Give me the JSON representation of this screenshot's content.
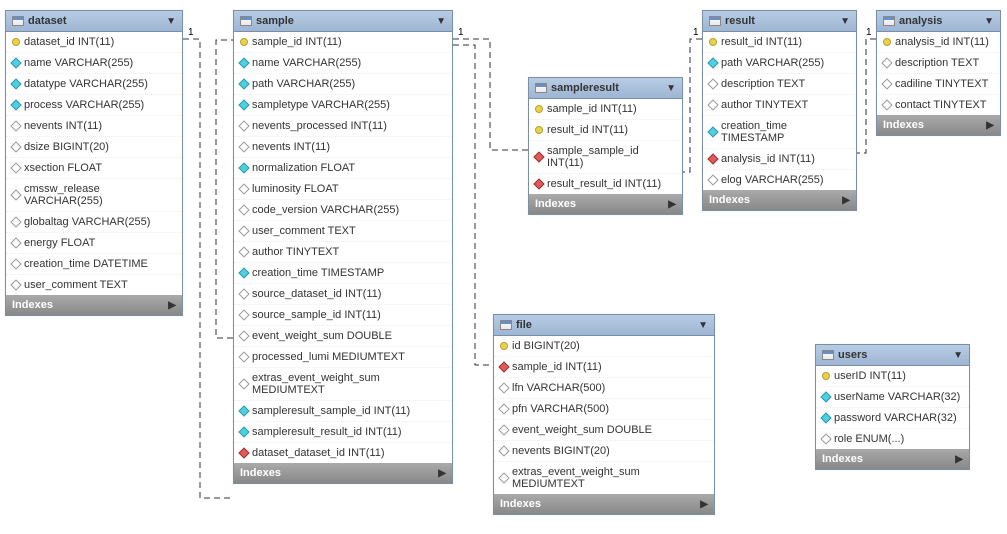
{
  "tables": {
    "dataset": {
      "title": "dataset",
      "columns": [
        {
          "icon": "key",
          "text": "dataset_id INT(11)"
        },
        {
          "icon": "cyan",
          "text": "name VARCHAR(255)"
        },
        {
          "icon": "cyan",
          "text": "datatype VARCHAR(255)"
        },
        {
          "icon": "cyan",
          "text": "process VARCHAR(255)"
        },
        {
          "icon": "open",
          "text": "nevents INT(11)"
        },
        {
          "icon": "open",
          "text": "dsize BIGINT(20)"
        },
        {
          "icon": "open",
          "text": "xsection FLOAT"
        },
        {
          "icon": "open",
          "text": "cmssw_release VARCHAR(255)"
        },
        {
          "icon": "open",
          "text": "globaltag VARCHAR(255)"
        },
        {
          "icon": "open",
          "text": "energy FLOAT"
        },
        {
          "icon": "open",
          "text": "creation_time DATETIME"
        },
        {
          "icon": "open",
          "text": "user_comment TEXT"
        }
      ],
      "indexes": "Indexes"
    },
    "sample": {
      "title": "sample",
      "columns": [
        {
          "icon": "key",
          "text": "sample_id INT(11)"
        },
        {
          "icon": "cyan",
          "text": "name VARCHAR(255)"
        },
        {
          "icon": "cyan",
          "text": "path VARCHAR(255)"
        },
        {
          "icon": "cyan",
          "text": "sampletype VARCHAR(255)"
        },
        {
          "icon": "open",
          "text": "nevents_processed INT(11)"
        },
        {
          "icon": "open",
          "text": "nevents INT(11)"
        },
        {
          "icon": "cyan",
          "text": "normalization FLOAT"
        },
        {
          "icon": "open",
          "text": "luminosity FLOAT"
        },
        {
          "icon": "open",
          "text": "code_version VARCHAR(255)"
        },
        {
          "icon": "open",
          "text": "user_comment TEXT"
        },
        {
          "icon": "open",
          "text": "author TINYTEXT"
        },
        {
          "icon": "cyan",
          "text": "creation_time TIMESTAMP"
        },
        {
          "icon": "open",
          "text": "source_dataset_id INT(11)"
        },
        {
          "icon": "open",
          "text": "source_sample_id INT(11)"
        },
        {
          "icon": "open",
          "text": "event_weight_sum DOUBLE"
        },
        {
          "icon": "open",
          "text": "processed_lumi MEDIUMTEXT"
        },
        {
          "icon": "open",
          "text": "extras_event_weight_sum MEDIUMTEXT"
        },
        {
          "icon": "cyan",
          "text": "sampleresult_sample_id INT(11)"
        },
        {
          "icon": "cyan",
          "text": "sampleresult_result_id INT(11)"
        },
        {
          "icon": "red",
          "text": "dataset_dataset_id INT(11)"
        }
      ],
      "indexes": "Indexes"
    },
    "sampleresult": {
      "title": "sampleresult",
      "columns": [
        {
          "icon": "key",
          "text": "sample_id INT(11)"
        },
        {
          "icon": "key",
          "text": "result_id INT(11)"
        },
        {
          "icon": "red",
          "text": "sample_sample_id INT(11)"
        },
        {
          "icon": "red",
          "text": "result_result_id INT(11)"
        }
      ],
      "indexes": "Indexes"
    },
    "result": {
      "title": "result",
      "columns": [
        {
          "icon": "key",
          "text": "result_id INT(11)"
        },
        {
          "icon": "cyan",
          "text": "path VARCHAR(255)"
        },
        {
          "icon": "open",
          "text": "description TEXT"
        },
        {
          "icon": "open",
          "text": "author TINYTEXT"
        },
        {
          "icon": "cyan",
          "text": "creation_time TIMESTAMP"
        },
        {
          "icon": "red",
          "text": "analysis_id INT(11)"
        },
        {
          "icon": "open",
          "text": "elog VARCHAR(255)"
        }
      ],
      "indexes": "Indexes"
    },
    "analysis": {
      "title": "analysis",
      "columns": [
        {
          "icon": "key",
          "text": "analysis_id INT(11)"
        },
        {
          "icon": "open",
          "text": "description TEXT"
        },
        {
          "icon": "open",
          "text": "cadiline TINYTEXT"
        },
        {
          "icon": "open",
          "text": "contact TINYTEXT"
        }
      ],
      "indexes": "Indexes"
    },
    "file": {
      "title": "file",
      "columns": [
        {
          "icon": "key",
          "text": "id BIGINT(20)"
        },
        {
          "icon": "red",
          "text": "sample_id INT(11)"
        },
        {
          "icon": "open",
          "text": "lfn VARCHAR(500)"
        },
        {
          "icon": "open",
          "text": "pfn VARCHAR(500)"
        },
        {
          "icon": "open",
          "text": "event_weight_sum DOUBLE"
        },
        {
          "icon": "open",
          "text": "nevents BIGINT(20)"
        },
        {
          "icon": "open",
          "text": "extras_event_weight_sum MEDIUMTEXT"
        }
      ],
      "indexes": "Indexes"
    },
    "users": {
      "title": "users",
      "columns": [
        {
          "icon": "key",
          "text": "userID INT(11)"
        },
        {
          "icon": "cyan",
          "text": "userName VARCHAR(32)"
        },
        {
          "icon": "cyan",
          "text": "password VARCHAR(32)"
        },
        {
          "icon": "open",
          "text": "role ENUM(...)"
        }
      ],
      "indexes": "Indexes"
    }
  },
  "relations": [
    {
      "from": "dataset",
      "to": "sample",
      "label_from": "1"
    },
    {
      "from": "sample",
      "to": "sample",
      "label_from": "1",
      "self": true
    },
    {
      "from": "sample",
      "to": "sampleresult",
      "label_from": "1"
    },
    {
      "from": "sample",
      "to": "file",
      "label_from": "1"
    },
    {
      "from": "result",
      "to": "sampleresult",
      "label_from": "1"
    },
    {
      "from": "analysis",
      "to": "result",
      "label_from": "1"
    }
  ],
  "labels": {
    "one": "1"
  }
}
